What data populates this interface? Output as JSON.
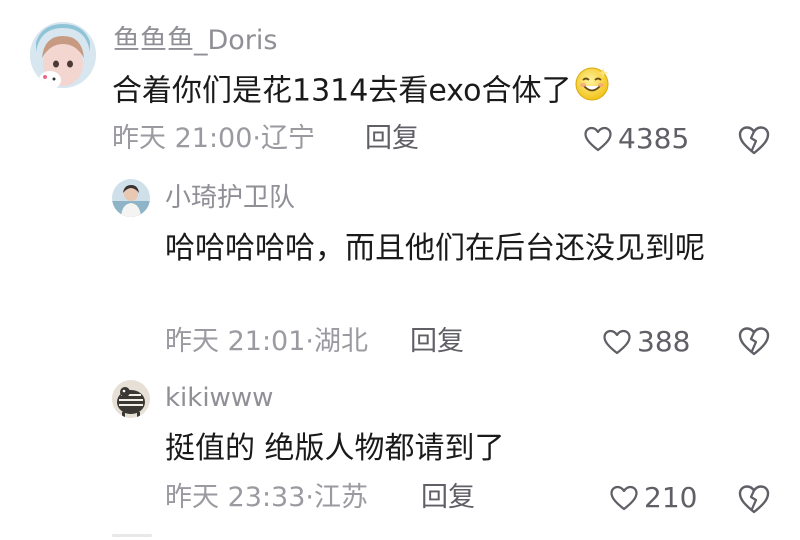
{
  "comments": [
    {
      "username": "鱼鱼鱼_Doris",
      "text": "合着你们是花1314去看exo合体了",
      "time_location": "昨天 21:00·辽宁",
      "reply_label": "回复",
      "likes": "4385",
      "icons": [
        "avatar",
        "smile-emoji-icon",
        "heart-icon",
        "dislike-icon"
      ]
    },
    {
      "username": "小琦护卫队",
      "text": "哈哈哈哈哈，而且他们在后台还没见到呢",
      "time_location": "昨天 21:01·湖北",
      "reply_label": "回复",
      "likes": "388",
      "icons": [
        "avatar",
        "heart-icon",
        "dislike-icon"
      ]
    },
    {
      "username": "kikiwww",
      "text": "挺值的 绝版人物都请到了",
      "time_location": "昨天 23:33·江苏",
      "reply_label": "回复",
      "likes": "210",
      "icons": [
        "avatar",
        "heart-icon",
        "dislike-icon"
      ]
    }
  ],
  "colors": {
    "username": "#8f8f96",
    "content": "#1a1a1a",
    "meta": "#9a9aa0",
    "action": "#5f5f66"
  }
}
